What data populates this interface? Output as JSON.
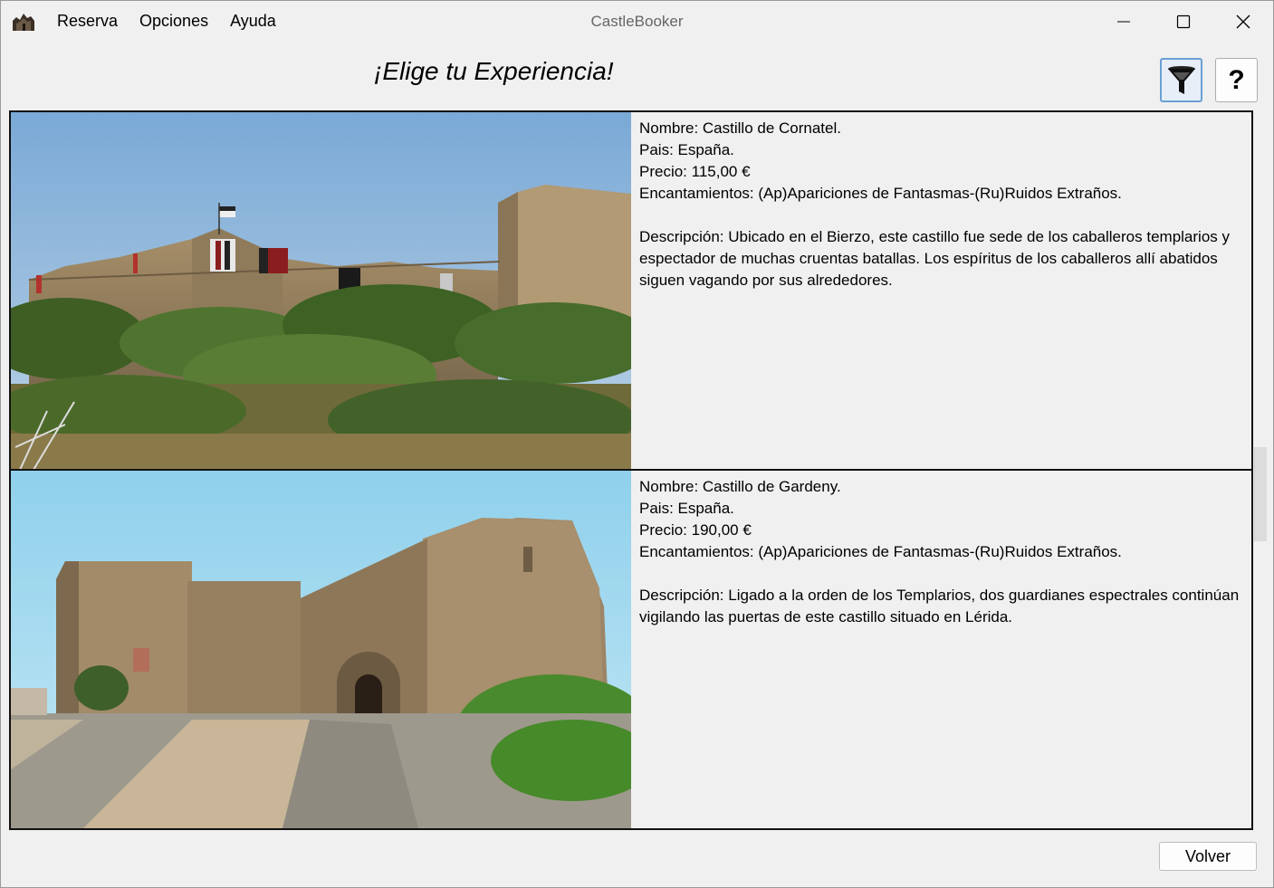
{
  "window": {
    "title": "CastleBooker",
    "menu": [
      {
        "label": "Reserva"
      },
      {
        "label": "Opciones"
      },
      {
        "label": "Ayuda"
      }
    ],
    "controls": [
      "minimize-icon",
      "maximize-icon",
      "close-icon"
    ]
  },
  "header": {
    "title": "¡Elige tu Experiencia!",
    "filter_icon": "funnel-icon",
    "help_label": "?"
  },
  "castles": [
    {
      "name": "Nombre: Castillo de Cornatel.",
      "country": "Pais: España.",
      "price": "Precio: 115,00 €",
      "charms": "Encantamientos: (Ap)Apariciones de Fantasmas-(Ru)Ruidos Extraños.",
      "description": "Descripción: Ubicado en el Bierzo, este castillo fue sede de los caballeros templarios y espectador de muchas cruentas batallas. Los espíritus de los caballeros allí abatidos siguen vagando por sus alrededores."
    },
    {
      "name": "Nombre: Castillo de Gardeny.",
      "country": "Pais: España.",
      "price": "Precio: 190,00 €",
      "charms": "Encantamientos: (Ap)Apariciones de Fantasmas-(Ru)Ruidos Extraños.",
      "description": "Descripción: Ligado a la orden de los Templarios, dos guardianes espectrales continúan vigilando las puertas de este castillo situado en  Lérida."
    }
  ],
  "footer": {
    "back_label": "Volver"
  }
}
